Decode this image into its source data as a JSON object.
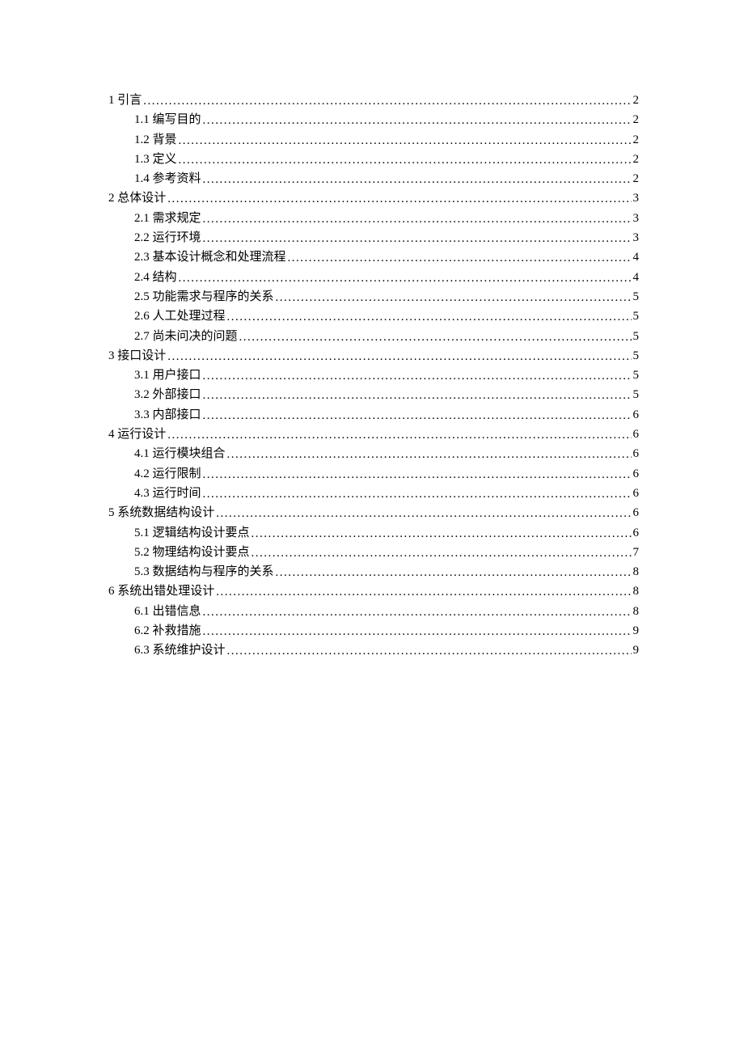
{
  "toc": [
    {
      "level": 1,
      "title": "1 引言",
      "page": "2"
    },
    {
      "level": 2,
      "title": "1.1 编写目的",
      "page": "2"
    },
    {
      "level": 2,
      "title": "1.2 背景",
      "page": "2"
    },
    {
      "level": 2,
      "title": "1.3 定义",
      "page": "2"
    },
    {
      "level": 2,
      "title": "1.4 参考资料",
      "page": "2"
    },
    {
      "level": 1,
      "title": "2 总体设计",
      "page": "3"
    },
    {
      "level": 2,
      "title": "2.1 需求规定",
      "page": "3"
    },
    {
      "level": 2,
      "title": "2.2 运行环境",
      "page": "3"
    },
    {
      "level": 2,
      "title": "2.3 基本设计概念和处理流程",
      "page": "4"
    },
    {
      "level": 2,
      "title": "2.4 结构",
      "page": "4"
    },
    {
      "level": 2,
      "title": "2.5 功能需求与程序的关系",
      "page": "5"
    },
    {
      "level": 2,
      "title": "2.6 人工处理过程",
      "page": "5"
    },
    {
      "level": 2,
      "title": "2.7 尚未问决的问题",
      "page": "5"
    },
    {
      "level": 1,
      "title": "3 接口设计",
      "page": "5"
    },
    {
      "level": 2,
      "title": "3.1 用户接口",
      "page": "5"
    },
    {
      "level": 2,
      "title": "3.2 外部接口",
      "page": "5"
    },
    {
      "level": 2,
      "title": "3.3 内部接口",
      "page": "6"
    },
    {
      "level": 1,
      "title": "4 运行设计",
      "page": "6"
    },
    {
      "level": 2,
      "title": "4.1 运行模块组合",
      "page": "6"
    },
    {
      "level": 2,
      "title": "4.2 运行限制",
      "page": "6"
    },
    {
      "level": 2,
      "title": "4.3 运行时间",
      "page": "6"
    },
    {
      "level": 1,
      "title": "5 系统数据结构设计",
      "page": "6"
    },
    {
      "level": 2,
      "title": "5.1 逻辑结构设计要点",
      "page": "6"
    },
    {
      "level": 2,
      "title": "5.2 物理结构设计要点",
      "page": "7"
    },
    {
      "level": 2,
      "title": "5.3 数据结构与程序的关系",
      "page": "8"
    },
    {
      "level": 1,
      "title": "6 系统出错处理设计",
      "page": "8"
    },
    {
      "level": 2,
      "title": "6.1 出错信息",
      "page": "8"
    },
    {
      "level": 2,
      "title": "6.2 补救措施",
      "page": "9"
    },
    {
      "level": 2,
      "title": "6.3 系统维护设计",
      "page": "9"
    }
  ]
}
